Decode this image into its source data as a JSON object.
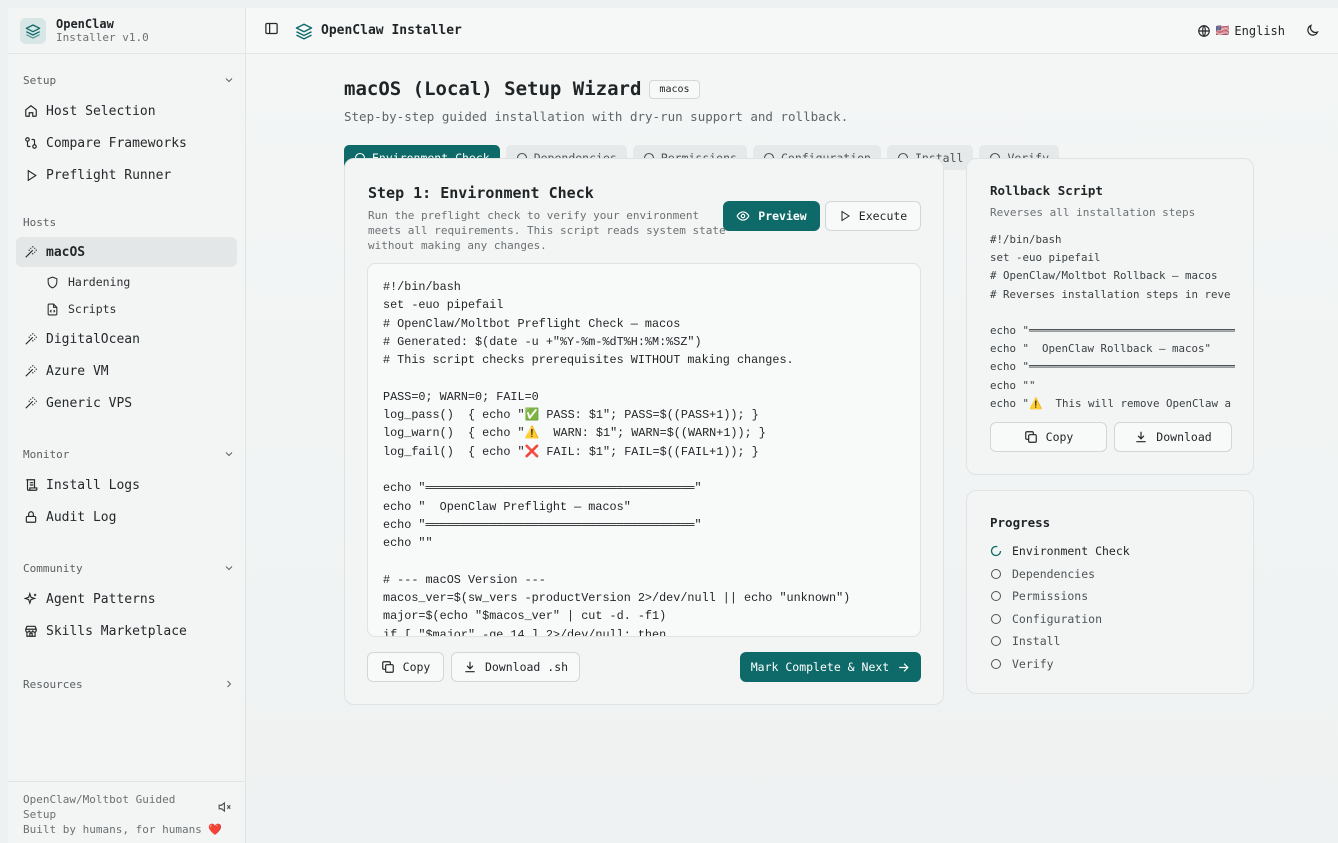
{
  "brand": {
    "title": "OpenClaw",
    "subtitle": "Installer v1.0"
  },
  "sidebar": {
    "sections": [
      {
        "title": "Setup",
        "items": [
          {
            "label": "Host Selection",
            "icon": "home-icon"
          },
          {
            "label": "Compare Frameworks",
            "icon": "compare-icon"
          },
          {
            "label": "Preflight Runner",
            "icon": "play-icon"
          }
        ]
      },
      {
        "title": "Hosts",
        "items": [
          {
            "label": "macOS",
            "icon": "wand-icon"
          },
          {
            "label": "Hardening",
            "icon": "shield-icon"
          },
          {
            "label": "Scripts",
            "icon": "file-code-icon"
          },
          {
            "label": "DigitalOcean",
            "icon": "wand-icon"
          },
          {
            "label": "Azure VM",
            "icon": "wand-icon"
          },
          {
            "label": "Generic VPS",
            "icon": "wand-icon"
          }
        ]
      },
      {
        "title": "Monitor",
        "items": [
          {
            "label": "Install Logs",
            "icon": "scroll-icon"
          },
          {
            "label": "Audit Log",
            "icon": "lock-icon"
          }
        ]
      },
      {
        "title": "Community",
        "items": [
          {
            "label": "Agent Patterns",
            "icon": "sparkles-icon"
          },
          {
            "label": "Skills Marketplace",
            "icon": "store-icon"
          }
        ]
      },
      {
        "title": "Resources",
        "items": []
      }
    ],
    "footer": {
      "line1": "OpenClaw/Moltbot Guided",
      "line2": "Setup",
      "line3": "Built by humans, for humans ❤️"
    }
  },
  "topbar": {
    "title": "OpenClaw Installer",
    "language": "English",
    "flag": "🇺🇸"
  },
  "wizard": {
    "title": "macOS (Local) Setup Wizard",
    "badge": "macos",
    "subtitle": "Step-by-step guided installation with dry-run support and rollback.",
    "steps": [
      "Environment Check",
      "Dependencies",
      "Permissions",
      "Configuration",
      "Install",
      "Verify"
    ],
    "active_step": 0
  },
  "step_card": {
    "title": "Step 1: Environment Check",
    "description_lines": [
      "Run the preflight check to verify your environment",
      "meets all requirements. This script reads system state",
      "without making any changes."
    ],
    "preview_label": "Preview",
    "execute_label": "Execute",
    "code": "#!/bin/bash\nset -euo pipefail\n# OpenClaw/Moltbot Preflight Check — macos\n# Generated: $(date -u +\"%Y-%m-%dT%H:%M:%SZ\")\n# This script checks prerequisites WITHOUT making changes.\n\nPASS=0; WARN=0; FAIL=0\nlog_pass()  { echo \"✅ PASS: $1\"; PASS=$((PASS+1)); }\nlog_warn()  { echo \"⚠️  WARN: $1\"; WARN=$((WARN+1)); }\nlog_fail()  { echo \"❌ FAIL: $1\"; FAIL=$((FAIL+1)); }\n\necho \"══════════════════════════════════════\"\necho \"  OpenClaw Preflight — macos\"\necho \"══════════════════════════════════════\"\necho \"\"\n\n# --- macOS Version ---\nmacos_ver=$(sw_vers -productVersion 2>/dev/null || echo \"unknown\")\nmajor=$(echo \"$macos_ver\" | cut -d. -f1)\nif [ \"$major\" -ge 14 ] 2>/dev/null; then",
    "copy_label": "Copy",
    "download_label": "Download .sh",
    "next_label": "Mark Complete & Next"
  },
  "rollback": {
    "title": "Rollback Script",
    "subtitle": "Reverses all installation steps",
    "code": "#!/bin/bash\nset -euo pipefail\n# OpenClaw/Moltbot Rollback — macos\n# Reverses installation steps in reve\n\necho \"══════════════════════════════════\necho \"  OpenClaw Rollback — macos\"\necho \"══════════════════════════════════\necho \"\"\necho \"⚠️  This will remove OpenClaw a",
    "copy_label": "Copy",
    "download_label": "Download"
  },
  "progress": {
    "title": "Progress",
    "items": [
      "Environment Check",
      "Dependencies",
      "Permissions",
      "Configuration",
      "Install",
      "Verify"
    ],
    "current": 0
  },
  "colors": {
    "accent": "#0e6a68",
    "sidebar_bg": "#f3f4f4",
    "card_bg": "#f3f5f5"
  }
}
